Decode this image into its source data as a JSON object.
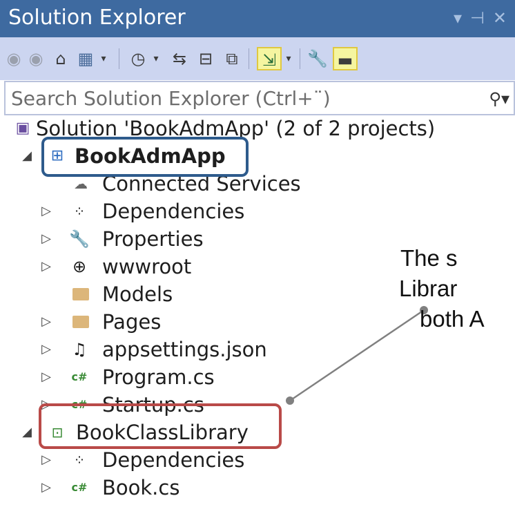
{
  "window": {
    "title": "Solution Explorer",
    "controls": [
      "▾",
      "⊣",
      "✕"
    ]
  },
  "toolbar": {
    "icons": [
      "back-icon",
      "forward-icon",
      "home-icon",
      "switch-views-icon",
      "dropdown-icon",
      "pending-changes-icon",
      "dropdown-icon",
      "sync-icon",
      "collapse-all-icon",
      "show-all-files-icon",
      "preview-icon",
      "dropdown-icon",
      "properties-icon",
      "minimize-icon"
    ]
  },
  "search": {
    "placeholder": "Search Solution Explorer (Ctrl+¨)",
    "icon": "search-icon"
  },
  "tree": {
    "solution": "Solution 'BookAdmApp' (2 of 2 projects)",
    "project1": {
      "name": "BookAdmApp",
      "items": [
        {
          "label": "Connected Services",
          "icon": "connected-services-icon",
          "expandable": false
        },
        {
          "label": "Dependencies",
          "icon": "dependencies-icon",
          "expandable": true
        },
        {
          "label": "Properties",
          "icon": "wrench-icon",
          "expandable": true
        },
        {
          "label": "wwwroot",
          "icon": "globe-icon",
          "expandable": true
        },
        {
          "label": "Models",
          "icon": "folder-icon",
          "expandable": false
        },
        {
          "label": "Pages",
          "icon": "folder-icon",
          "expandable": true
        },
        {
          "label": "appsettings.json",
          "icon": "json-file-icon",
          "expandable": true
        },
        {
          "label": "Program.cs",
          "icon": "csharp-file-icon",
          "expandable": true
        },
        {
          "label": "Startup.cs",
          "icon": "csharp-file-icon",
          "expandable": true
        }
      ]
    },
    "project2": {
      "name": "BookClassLibrary",
      "items": [
        {
          "label": "Dependencies",
          "icon": "dependencies-icon",
          "expandable": true
        },
        {
          "label": "Book.cs",
          "icon": "csharp-file-icon",
          "expandable": true
        }
      ]
    }
  },
  "callout": {
    "lines": [
      "The s",
      "Librar",
      "both A"
    ]
  },
  "colors": {
    "title_bar": "#3e6aa0",
    "toolbar": "#ccd5f0",
    "highlight_blue": "#2e5b8c",
    "highlight_red": "#b94a48",
    "connector": "#808080"
  }
}
